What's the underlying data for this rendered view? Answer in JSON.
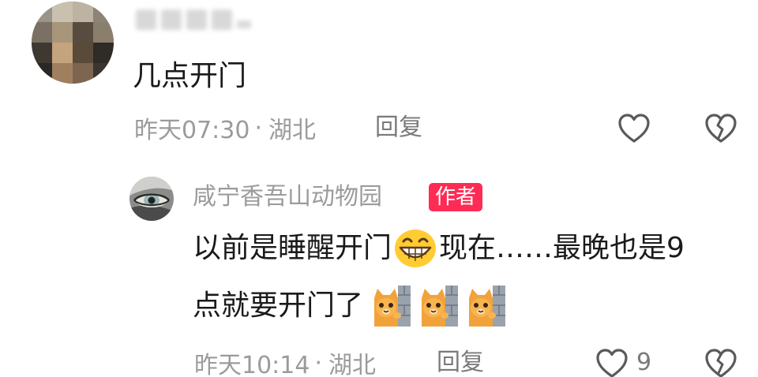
{
  "comment": {
    "username": "",
    "text": "几点开门",
    "time": "昨天07:30",
    "separator": "·",
    "location": "湖北",
    "reply_label": "回复"
  },
  "reply": {
    "username": "咸宁香吾山动物园",
    "badge": "作者",
    "text_part1": "以前是睡醒开门",
    "text_part2": "现在……最晚也是9",
    "text_line2": "点就要开门了",
    "time": "昨天10:14",
    "separator": "·",
    "location": "湖北",
    "reply_label": "回复",
    "like_count": "9"
  },
  "icons": {
    "like": "heart-outline-icon",
    "dislike": "broken-heart-icon",
    "emoji_1": "grinning-face-emoji",
    "emoji_2": "peeking-cat-wall-emoji"
  },
  "colors": {
    "text_primary": "#1a1a1a",
    "text_secondary": "#9b9b9b",
    "badge_bg": "#fe2c55",
    "badge_text": "#ffffff"
  }
}
